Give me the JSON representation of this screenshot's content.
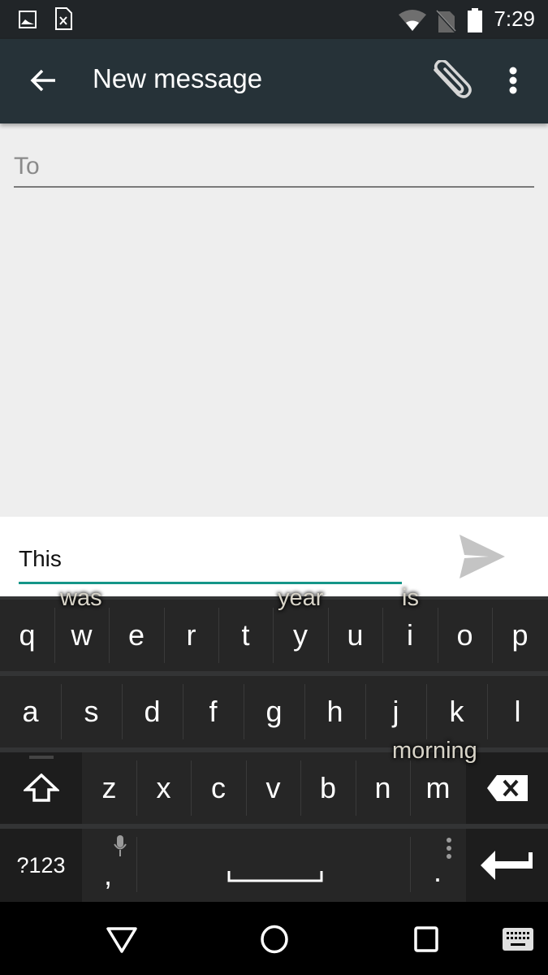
{
  "status_bar": {
    "time": "7:29",
    "left_icons": [
      "image-notification-icon",
      "sim-error-notification-icon"
    ],
    "right_icons": [
      "wifi-icon",
      "no-sim-icon",
      "battery-icon"
    ]
  },
  "app_bar": {
    "title": "New message",
    "back_icon": "arrow-back-icon",
    "attach_icon": "paperclip-icon",
    "more_icon": "more-vert-icon"
  },
  "compose": {
    "to_placeholder": "To",
    "message_value": "This",
    "accent_color": "#159688"
  },
  "keyboard": {
    "suggestions": [
      "was",
      "year",
      "is",
      "morning"
    ],
    "row1": [
      "q",
      "w",
      "e",
      "r",
      "t",
      "y",
      "u",
      "i",
      "o",
      "p"
    ],
    "row2": [
      "a",
      "s",
      "d",
      "f",
      "g",
      "h",
      "j",
      "k",
      "l"
    ],
    "row3": [
      "z",
      "x",
      "c",
      "v",
      "b",
      "n",
      "m"
    ],
    "symbols_label": "?123",
    "comma": ",",
    "period": "."
  },
  "nav_bar": {
    "icons": [
      "back-icon",
      "home-icon",
      "recents-icon",
      "keyboard-switch-icon"
    ]
  }
}
